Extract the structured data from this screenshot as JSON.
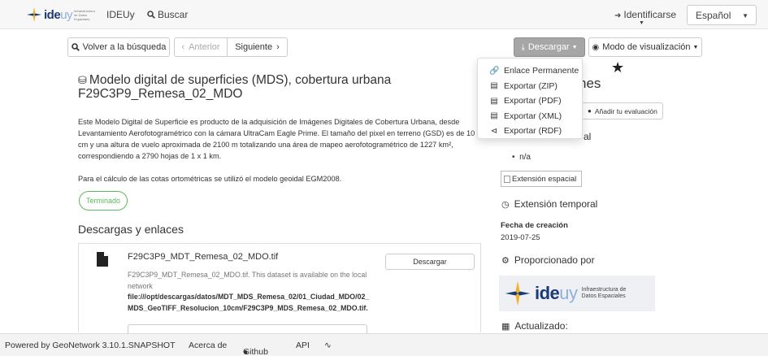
{
  "nav": {
    "logo_text_a": "ide",
    "logo_text_b": "uy",
    "logo_sub": "Infraestructura de Datos Espaciales",
    "home_link": "IDEUy",
    "search_link": "Buscar",
    "login": "Identificarse",
    "language": "Español"
  },
  "toolbar": {
    "back": "Volver a la búsqueda",
    "prev": "Anterior",
    "next": "Siguiente",
    "download": "Descargar",
    "view_mode": "Modo de visualización"
  },
  "dropdown": {
    "items": [
      {
        "label": "Enlace Permanente",
        "icon": "link-icon"
      },
      {
        "label": "Exportar (ZIP)",
        "icon": "file-zip-icon"
      },
      {
        "label": "Exportar (PDF)",
        "icon": "file-pdf-icon"
      },
      {
        "label": "Exportar (XML)",
        "icon": "file-xml-icon"
      },
      {
        "label": "Exportar (RDF)",
        "icon": "share-icon"
      }
    ]
  },
  "main": {
    "title": "Modelo digital de superficies (MDS), cobertura urbana F29C3P9_Remesa_02_MDO",
    "description": "Este Modelo Digital de Superficie es producto de la adquisición de Imágenes Digitales de Cobertura Urbana, desde Levantamiento Aerofotogramétrico con la cámara UltraCam Eagle Prime. El tamaño del pixel en terreno (GSD) es de 10 cm y una altura de vuelo aproximada de 2100 m totalizando una área de mapeo aerofotogramétrico de 1227 km², correspondiendo a 2790 hojas de 1 x 1 km.",
    "description2": "Para el cálculo de las cotas ortométricas se utilizó el modelo geoidal EGM2008.",
    "status": "Terminado",
    "downloads_heading": "Descargas y enlaces",
    "download_item": {
      "name": "F29C3P9_MDT_Remesa_02_MDO.tif",
      "text": "F29C3P9_MDT_Remesa_02_MDO.tif. This dataset is available on the local network",
      "path": "file:///opt/descargas/datos/MDT_MDS_Remesa_02/01_Ciudad_MDO/02_MDS_GeoTIFF_Resolucion_10cm/F29C3P9_MDS_Remesa_02_MDO.tif.",
      "button": "Descargar"
    }
  },
  "sidebar": {
    "heading_partial": "nes",
    "eval_button": "Añadir tu evaluación",
    "partial_al": "al",
    "na": "n/a",
    "image_alt": "Extensión espacial",
    "temporal_heading": "Extensión temporal",
    "creation_label": "Fecha de creación",
    "creation_date": "2019-07-25",
    "provided_heading": "Proporcionado por",
    "provider_sub": "Infraestructura de Datos Espaciales",
    "updated_heading": "Actualizado:"
  },
  "footer": {
    "powered": "Powered by GeoNetwork 3.10.1.SNAPSHOT",
    "about": "Acerca de",
    "github": "Github",
    "api": "API"
  }
}
